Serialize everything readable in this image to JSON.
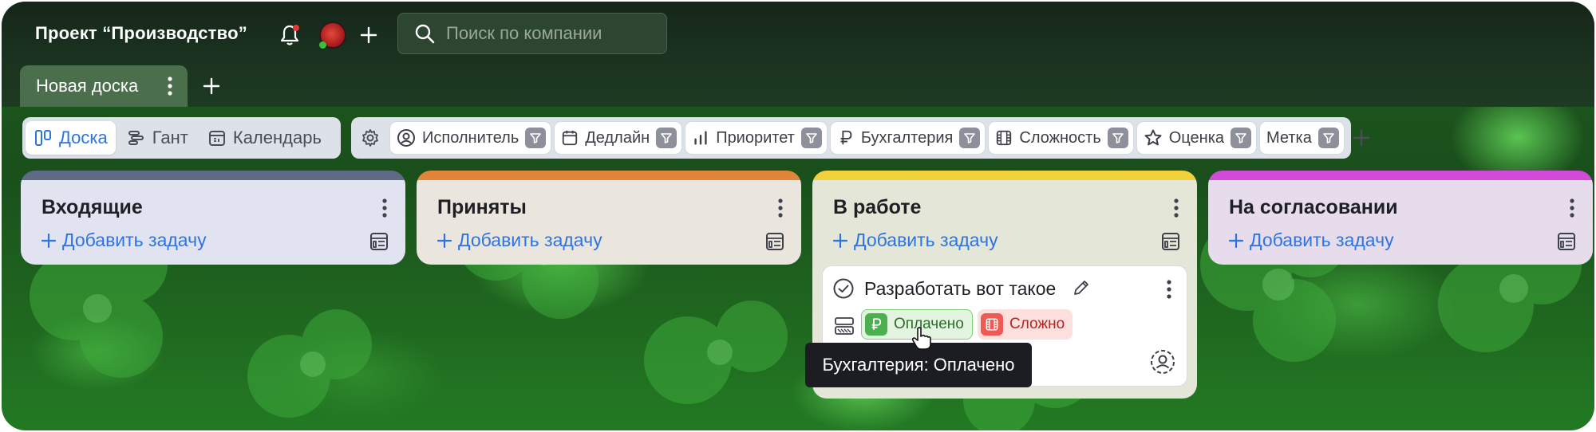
{
  "header": {
    "project_title": "Проект “Производство”",
    "search": {
      "placeholder": "Поиск по компании",
      "value": ""
    },
    "icons": [
      "bell-icon",
      "avatar",
      "plus-icon",
      "search-icon"
    ]
  },
  "boards": {
    "tabs": [
      {
        "label": "Новая доска",
        "active": true
      }
    ]
  },
  "views": [
    {
      "label": "Доска",
      "icon": "board-icon",
      "active": true
    },
    {
      "label": "Гант",
      "icon": "gantt-icon",
      "active": false
    },
    {
      "label": "Календарь",
      "icon": "calendar-icon",
      "active": false
    }
  ],
  "filters": [
    {
      "label": "Исполнитель",
      "icon": "user-circle-icon"
    },
    {
      "label": "Дедлайн",
      "icon": "calendar-icon"
    },
    {
      "label": "Приоритет",
      "icon": "bar-chart-icon"
    },
    {
      "label": "Бухгалтерия",
      "icon": "ruble-icon"
    },
    {
      "label": "Сложность",
      "icon": "film-icon"
    },
    {
      "label": "Оценка",
      "icon": "star-icon"
    },
    {
      "label": "Метка",
      "icon": ""
    }
  ],
  "columns": [
    {
      "title": "Входящие",
      "add_label": "Добавить задачу",
      "color": "#5f6a86"
    },
    {
      "title": "Приняты",
      "add_label": "Добавить задачу",
      "color": "#e0863a"
    },
    {
      "title": "В работе",
      "add_label": "Добавить задачу",
      "color": "#f3d13d"
    },
    {
      "title": "На согласовании",
      "add_label": "Добавить задачу",
      "color": "#d24ad8"
    }
  ],
  "card": {
    "title": "Разработать вот такое",
    "tags": [
      {
        "label": "Оплачено",
        "icon": "ruble-icon",
        "color": "#4caf50"
      },
      {
        "label": "Сложно",
        "icon": "film-icon",
        "color": "#f05a55"
      }
    ]
  },
  "tooltip": {
    "text": "Бухгалтерия: Оплачено"
  },
  "colors": {
    "accent": "#2d74e0",
    "header_bg": "#16261a"
  }
}
